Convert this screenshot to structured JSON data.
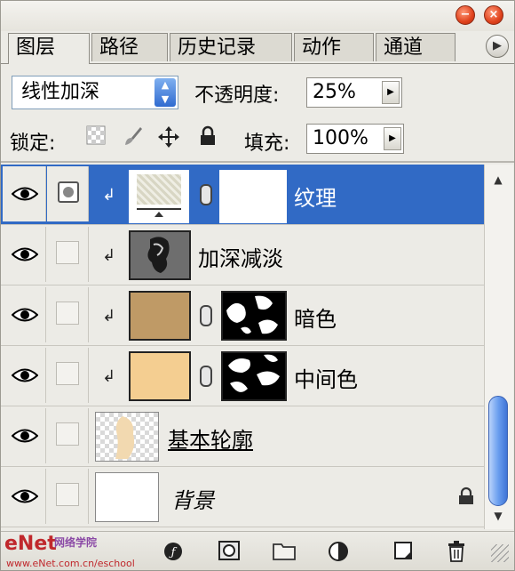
{
  "tabs": [
    "图层",
    "路径",
    "历史记录",
    "动作",
    "通道"
  ],
  "blend_mode": "线性加深",
  "opacity": {
    "label": "不透明度:",
    "value": "25%"
  },
  "lock": {
    "label": "锁定:"
  },
  "fill": {
    "label": "填充:",
    "value": "100%"
  },
  "layers": [
    {
      "name": "纹理"
    },
    {
      "name": "加深减淡"
    },
    {
      "name": "暗色"
    },
    {
      "name": "中间色"
    },
    {
      "name": "基本轮廓"
    },
    {
      "name": "背景"
    }
  ],
  "watermark": {
    "logo": "eNet",
    "cn": "网络学院",
    "url": "www.eNet.com.cn/eschool"
  },
  "colors": {
    "selection": "#316ac5",
    "close_button": "#e0421c",
    "scroll_thumb": "#6b9fef"
  }
}
